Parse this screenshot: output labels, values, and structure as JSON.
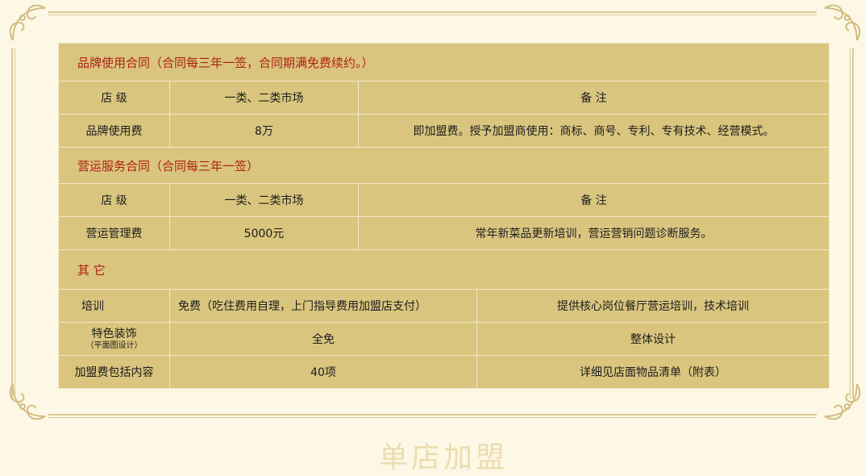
{
  "brand_contract": {
    "title": "品牌使用合同（合同每三年一签，合同期满免费续约。）",
    "col_level": "店 级",
    "col_market": "一类、二类市场",
    "col_note": "备 注",
    "row_label": "品牌使用费",
    "row_value": "8万",
    "row_note": "即加盟费。授予加盟商使用：商标、商号、专利、专有技术、经营模式。"
  },
  "ops_contract": {
    "title": "营运服务合同（合同每三年一签）",
    "col_level": "店 级",
    "col_market": "一类、二类市场",
    "col_note": "备 注",
    "row_label": "营运管理费",
    "row_value": "5000元",
    "row_note": "常年新菜品更新培训，营运营销问题诊断服务。"
  },
  "other": {
    "title": "其 它",
    "rows": [
      {
        "label": "培训",
        "label_note": "",
        "value": "免费（吃住费用自理，上门指导费用加盟店支付）",
        "note": "提供核心岗位餐厅营运培训，技术培训"
      },
      {
        "label": "特色装饰",
        "label_note": "（平面图设计）",
        "value": "全免",
        "note": "整体设计"
      },
      {
        "label": "加盟费包括内容",
        "label_note": "",
        "value": "40项",
        "note": "详细见店面物品清单（附表）"
      }
    ]
  },
  "footer_heading": "单店加盟"
}
